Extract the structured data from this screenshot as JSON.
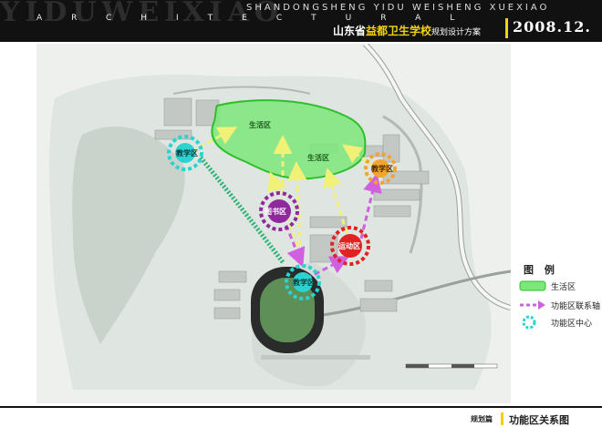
{
  "header": {
    "watermark": "YIDUWEIXIAO",
    "english_title": "SHANDONGSHENG YIDU WEISHENG XUEXIAO",
    "architectural": "ARCHITECTURAL",
    "title_part1": "山东省",
    "title_highlight": "益都卫生学校",
    "title_part2": "规划设计方案",
    "year": "2008.12."
  },
  "map": {
    "zones": {
      "living_upper": "生活区",
      "living_lower": "生活区"
    },
    "nodes": {
      "teaching_w": "教学区",
      "library": "图书区",
      "sports": "运动区",
      "culture": "教学区",
      "teaching_s": "教学区"
    }
  },
  "legend": {
    "title": "图 例",
    "items": [
      {
        "label": "生活区",
        "color": "#7de77a"
      },
      {
        "label": "功能区联系轴",
        "color": "#d060e0"
      },
      {
        "label": "功能区中心",
        "color": "#2bd3d0"
      }
    ]
  },
  "footer": {
    "label": "规划篇",
    "title": "功能区关系图"
  },
  "colors": {
    "accent": "#f3d20d",
    "living_zone": "#7de77a",
    "axis": "#d060e0",
    "axis_yellow": "#f1f177",
    "node_teal": "#2bd3d0",
    "node_purple": "#8e2a9c",
    "node_red": "#e02222",
    "node_orange": "#f2a52c"
  }
}
